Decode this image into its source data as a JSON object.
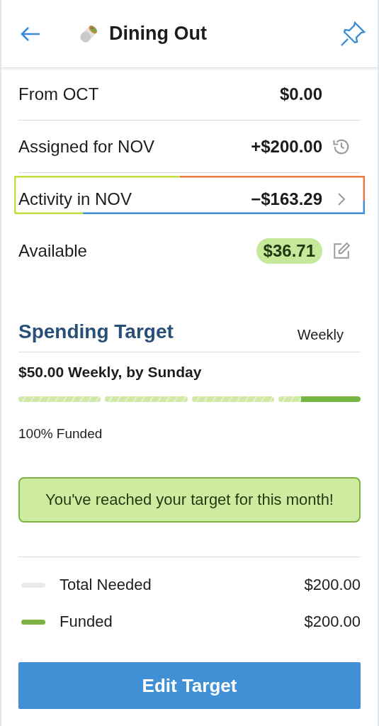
{
  "header": {
    "title": "Dining Out"
  },
  "rows": [
    {
      "kind": "plain",
      "label": "From OCT",
      "amount": "$0.00"
    },
    {
      "kind": "history",
      "label": "Assigned for NOV",
      "amount": "+$200.00"
    },
    {
      "kind": "link",
      "label": "Activity in NOV",
      "amount": "−$163.29"
    },
    {
      "kind": "available",
      "label": "Available",
      "amount": "$36.71"
    }
  ],
  "target": {
    "title": "Spending Target",
    "cadence": "Weekly",
    "summary": "$50.00 Weekly, by Sunday",
    "segments": [
      {
        "kind": "hatched"
      },
      {
        "kind": "hatched"
      },
      {
        "kind": "hatched"
      },
      {
        "kind": "partial",
        "level": 0.72
      }
    ],
    "funded_label": "100% Funded",
    "message": "You've reached your target for this month!"
  },
  "legend": [
    {
      "label": "Total Needed",
      "amount": "$200.00",
      "color": "#e8eaee"
    },
    {
      "label": "Funded",
      "amount": "$200.00",
      "color": "#7cb342"
    }
  ],
  "button": "Edit Target"
}
